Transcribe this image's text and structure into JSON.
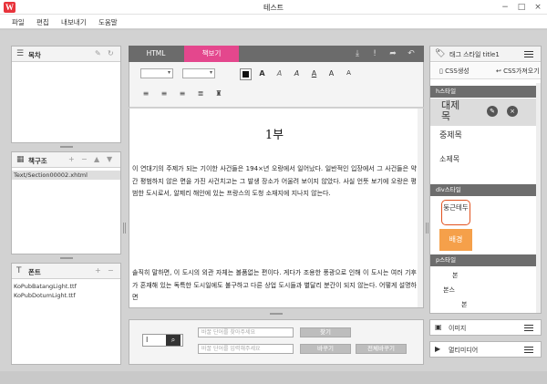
{
  "app": {
    "title": "테스트",
    "logo": "W",
    "window_controls": [
      "−",
      "□",
      "×"
    ]
  },
  "menu": [
    "파일",
    "편집",
    "내보내기",
    "도움말"
  ],
  "panels": {
    "toc": {
      "title": "목차"
    },
    "book_structure": {
      "title": "책구조",
      "files": [
        "Text/Section00002.xhtml"
      ]
    },
    "fonts": {
      "title": "폰트",
      "files": [
        "KoPubBatangLight.ttf",
        "KoPubDotumLight.ttf"
      ]
    }
  },
  "editor": {
    "tabs": {
      "html": "HTML",
      "view": "책보기"
    },
    "font_buttons": [
      "A",
      "A",
      "A",
      "A",
      "A",
      "A"
    ],
    "doc_title": "1부",
    "paragraphs": [
      "이 연대기의 주제가 되는 기이한 사건들은 194×년 오랑에서 일어났다. 일반적인 입장에서 그 사건들은 약간 평범하지 않은 면을 가진 사건치고는 그 발생 장소가 어울려 보이지 않았다. 사실 언뜻 보기에 오랑은 평범한 도시로서, 알제리 해안에 있는 프랑스의 도청 소재지에 지나지 않는다.",
      "솔직히 말하면, 이 도시의 외관 자체는 볼품없는 편이다. 게다가 조용한 풍광으로 인해 이 도시는 여러 기후가 혼재해 있는 독특한 도시일에도 불구하고 다른 상업 도시들과 별달리 분간이 되지 않는다. 어떻게 설명하면"
    ]
  },
  "find": {
    "search_placeholder": "바꿀 단어를 찾아주세요",
    "replace_placeholder": "바꿀 단어를 입력해주세요",
    "find_label": "찾기",
    "replace_label": "바꾸기",
    "replace_all_label": "전체바꾸기"
  },
  "styles_panel": {
    "title": "태그 스타일 title1",
    "css_create": "CSS생성",
    "css_import": "CSS가져오기",
    "h_section": "h스타일",
    "h_items": [
      "대제목",
      "중제목",
      "소제목"
    ],
    "div_section": "div스타일",
    "div_items": [
      "둥근테두",
      "배경"
    ],
    "p_section": "p스타일",
    "p_items": [
      "본",
      "본스",
      "본"
    ],
    "image_label": "이미지",
    "media_label": "멀티미디어"
  },
  "colors": {
    "tab_active": "#e4478d",
    "logo": "#e8343c",
    "round_border": "#e2521f",
    "background_item": "#f5a04a"
  }
}
